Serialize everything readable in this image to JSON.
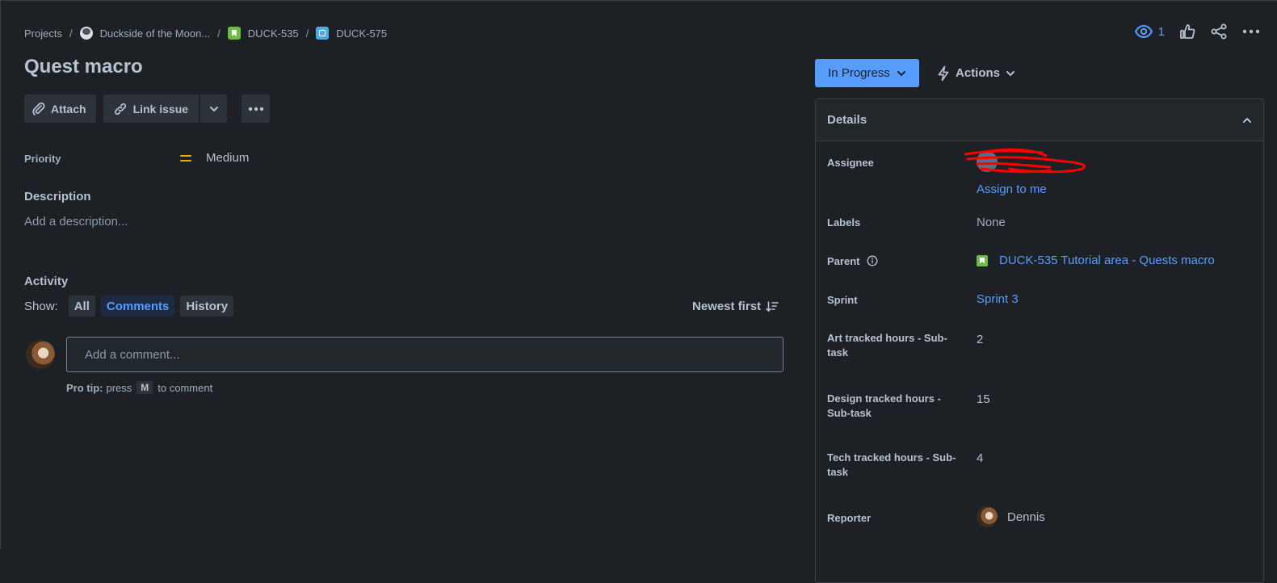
{
  "breadcrumb": {
    "items": [
      {
        "label": "Projects"
      },
      {
        "label": "Duckside of the Moon..."
      },
      {
        "label": "DUCK-535"
      },
      {
        "label": "DUCK-575"
      }
    ],
    "separator": "/"
  },
  "header": {
    "watch_count": "1"
  },
  "issue": {
    "title": "Quest macro"
  },
  "toolbar": {
    "attach_label": "Attach",
    "link_issue_label": "Link issue"
  },
  "fields": {
    "priority_label": "Priority",
    "priority_value": "Medium"
  },
  "description": {
    "heading": "Description",
    "placeholder": "Add a description..."
  },
  "activity": {
    "heading": "Activity",
    "show_label": "Show:",
    "filters": [
      {
        "label": "All",
        "active": false
      },
      {
        "label": "Comments",
        "active": true
      },
      {
        "label": "History",
        "active": false
      }
    ],
    "sort_label": "Newest first",
    "comment_placeholder": "Add a comment...",
    "pro_tip_bold": "Pro tip:",
    "pro_tip_pre": "press",
    "pro_tip_key": "M",
    "pro_tip_post": "to comment"
  },
  "status": {
    "current": "In Progress",
    "actions_label": "Actions"
  },
  "details": {
    "heading": "Details",
    "assignee_label": "Assignee",
    "assign_to_me": "Assign to me",
    "labels_label": "Labels",
    "labels_value": "None",
    "parent_label": "Parent",
    "parent_value": "DUCK-535 Tutorial area - Quests macro",
    "sprint_label": "Sprint",
    "sprint_value": "Sprint 3",
    "art_hours_label": "Art tracked hours - Sub-task",
    "art_hours_value": "2",
    "design_hours_label": "Design tracked hours - Sub-task",
    "design_hours_value": "15",
    "tech_hours_label": "Tech tracked hours - Sub-task",
    "tech_hours_value": "4",
    "reporter_label": "Reporter",
    "reporter_value": "Dennis"
  },
  "colors": {
    "background": "#1d2125",
    "accent": "#579dff",
    "priority_medium": "#e2b203",
    "story_green": "#6bbd45",
    "subtask_blue": "#4bade8"
  }
}
